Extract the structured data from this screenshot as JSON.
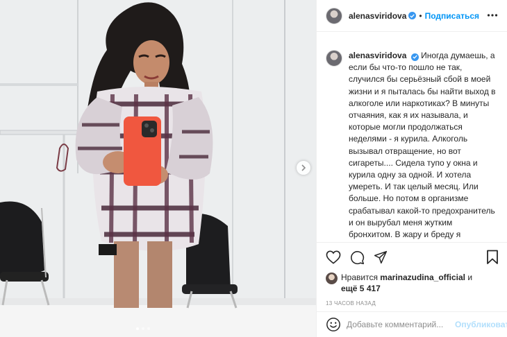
{
  "post": {
    "username": "alenasviridova",
    "follow_label": "Подписаться",
    "separator": "•",
    "caption_text": "Иногда думаешь, а если бы что-то пошло не так, случился бы серьёзный сбой в моей жизни и я пыталась бы найти выход в алкоголе или наркотиках? В минуты отчаяния, как я их называла, и которые могли продолжаться неделями - я курила. Алкоголь вызывал отвращение, но вот сигареты.... Сидела тупо у окна и курила одну за одной. И хотела умереть. И так целый месяц. Или больше. Но потом в организме срабатывал какой-то предохранитель и он вырубал меня жутким бронхитом. В жару и бреду я выкашливала всю гадость, которой удалось за это время забить свои лёгкие. И когда температура падала",
    "likes": {
      "prefix": "Нравится",
      "liker": "marinazudina_official",
      "conjunction": "и",
      "others": "ещё 5 417"
    },
    "timestamp": "13 часов назад"
  },
  "carousel": {
    "total": 3,
    "active": 0
  },
  "comment": {
    "placeholder": "Добавьте комментарий...",
    "publish_label": "Опубликовать"
  },
  "colors": {
    "accent": "#0095f6",
    "verified": "#3897f0",
    "publish_disabled": "#b2dffc",
    "phone_case": "#f0573f"
  },
  "icons": [
    "more-icon",
    "verified-icon",
    "heart-icon",
    "comment-icon",
    "share-icon",
    "bookmark-icon",
    "emoji-icon",
    "chevron-right-icon"
  ]
}
